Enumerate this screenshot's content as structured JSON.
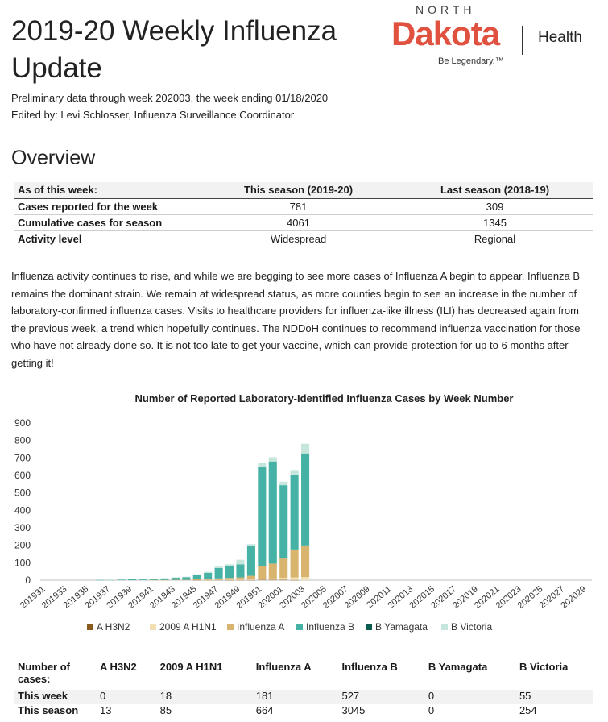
{
  "header": {
    "title": "2019-20 Weekly Influenza Update",
    "subtitle": "Preliminary data through week 202003, the week ending 01/18/2020",
    "editor": "Edited by: Levi Schlosser, Influenza Surveillance Coordinator"
  },
  "logo": {
    "north": "NORTH",
    "dakota": "Dakota",
    "health": "Health",
    "tagline": "Be Legendary.™"
  },
  "overview": {
    "heading": "Overview",
    "columns": [
      "As of this week:",
      "This season (2019-20)",
      "Last season (2018-19)"
    ],
    "rows": [
      [
        "Cases reported for the week",
        "781",
        "309"
      ],
      [
        "Cumulative cases for season",
        "4061",
        "1345"
      ],
      [
        "Activity level",
        "Widespread",
        "Regional"
      ]
    ],
    "paragraph": "Influenza activity continues to rise, and while we are begging to see more cases of Influenza A begin to appear, Influenza B remains the dominant strain. We remain at widespread status, as more counties begin to see an increase in the number of laboratory-confirmed influenza cases. Visits to healthcare providers for influenza-like illness (ILI) has decreased again from the previous week, a trend which hopefully continues. The NDDoH continues to recommend influenza vaccination for those who have not already done so. It is not too late to get your vaccine, which can provide protection for up to 6 months after getting it!"
  },
  "chart_data": {
    "type": "bar",
    "stacked": true,
    "title": "Number of Reported Laboratory-Identified Influenza Cases by Week Number",
    "xlabel": "",
    "ylabel": "",
    "ylim": [
      0,
      900
    ],
    "yticks": [
      0,
      100,
      200,
      300,
      400,
      500,
      600,
      700,
      800,
      900
    ],
    "grid": false,
    "legend": "bottom",
    "categories": [
      "201931",
      "201932",
      "201933",
      "201934",
      "201935",
      "201936",
      "201937",
      "201938",
      "201939",
      "201940",
      "201941",
      "201942",
      "201943",
      "201944",
      "201945",
      "201946",
      "201947",
      "201948",
      "201949",
      "201950",
      "201951",
      "201952",
      "202001",
      "202002",
      "202003",
      "202004",
      "202005",
      "202006",
      "202007",
      "202008",
      "202009",
      "202010",
      "202011",
      "202012",
      "202013",
      "202014",
      "202015",
      "202016",
      "202017",
      "202018",
      "202019",
      "202020",
      "202021",
      "202022",
      "202023",
      "202024",
      "202025",
      "202026",
      "202027",
      "202028",
      "202029"
    ],
    "tick_labels": [
      "201931",
      "201933",
      "201935",
      "201937",
      "201939",
      "201941",
      "201943",
      "201945",
      "201947",
      "201949",
      "201951",
      "202001",
      "202003",
      "202005",
      "202007",
      "202009",
      "202011",
      "202013",
      "202015",
      "202017",
      "202019",
      "202021",
      "202023",
      "202025",
      "202027",
      "202029"
    ],
    "series": [
      {
        "name": "A H3N2",
        "color": "#8a5a1c",
        "values": [
          0,
          0,
          0,
          0,
          0,
          0,
          0,
          0,
          0,
          0,
          0,
          0,
          0,
          0,
          1,
          1,
          1,
          1,
          1,
          1,
          2,
          2,
          2,
          1,
          0
        ]
      },
      {
        "name": "2009 A H1N1",
        "color": "#f2dfb4",
        "values": [
          0,
          0,
          0,
          0,
          0,
          0,
          0,
          0,
          0,
          0,
          0,
          0,
          0,
          0,
          0,
          1,
          1,
          2,
          3,
          4,
          6,
          8,
          12,
          15,
          18
        ]
      },
      {
        "name": "Influenza A",
        "color": "#d8b46e",
        "values": [
          0,
          0,
          0,
          0,
          0,
          0,
          0,
          0,
          0,
          0,
          1,
          1,
          2,
          2,
          4,
          5,
          8,
          10,
          12,
          20,
          75,
          85,
          110,
          160,
          181
        ]
      },
      {
        "name": "Influenza B",
        "color": "#46b2a6",
        "values": [
          0,
          0,
          0,
          0,
          0,
          1,
          2,
          4,
          6,
          5,
          7,
          9,
          12,
          15,
          25,
          35,
          60,
          68,
          75,
          170,
          565,
          585,
          420,
          425,
          527
        ]
      },
      {
        "name": "B Yamagata",
        "color": "#0b5c4f",
        "values": [
          0,
          0,
          0,
          0,
          0,
          0,
          0,
          0,
          0,
          0,
          0,
          0,
          0,
          0,
          0,
          0,
          0,
          0,
          0,
          0,
          0,
          0,
          0,
          0,
          0
        ]
      },
      {
        "name": "B Victoria",
        "color": "#c6e6dd",
        "values": [
          0,
          0,
          0,
          0,
          0,
          0,
          1,
          1,
          2,
          1,
          1,
          2,
          2,
          3,
          4,
          6,
          8,
          10,
          26,
          12,
          26,
          24,
          20,
          30,
          55
        ]
      }
    ]
  },
  "cases_table": {
    "columns": [
      "Number of cases:",
      "A H3N2",
      "2009 A H1N1",
      "Influenza A",
      "Influenza B",
      "B Yamagata",
      "B Victoria"
    ],
    "rows": [
      [
        "This week",
        "0",
        "18",
        "181",
        "527",
        "0",
        "55"
      ],
      [
        "This season",
        "13",
        "85",
        "664",
        "3045",
        "0",
        "254"
      ]
    ]
  }
}
